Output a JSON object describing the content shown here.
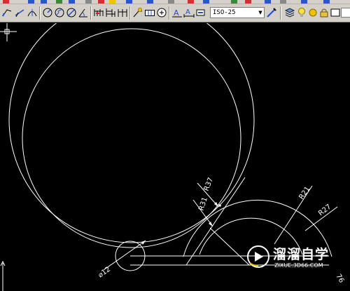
{
  "toolbar": {
    "dimension_style": "ISO-25"
  },
  "dimensions": {
    "r37": "R37",
    "r31": "R31",
    "r21": "R21",
    "r27": "R27",
    "d12": "⌀12",
    "edge_label": "76"
  },
  "watermark": {
    "brand": "溜溜自学",
    "url": "ZIXUE.3D66.COM"
  },
  "colors": {
    "canvas_bg": "#000000",
    "geometry": "#ffffff",
    "toolbar_bg": "#d4d0c8",
    "accent_blue": "#1e4fd0",
    "accent_yellow": "#f2c200"
  }
}
